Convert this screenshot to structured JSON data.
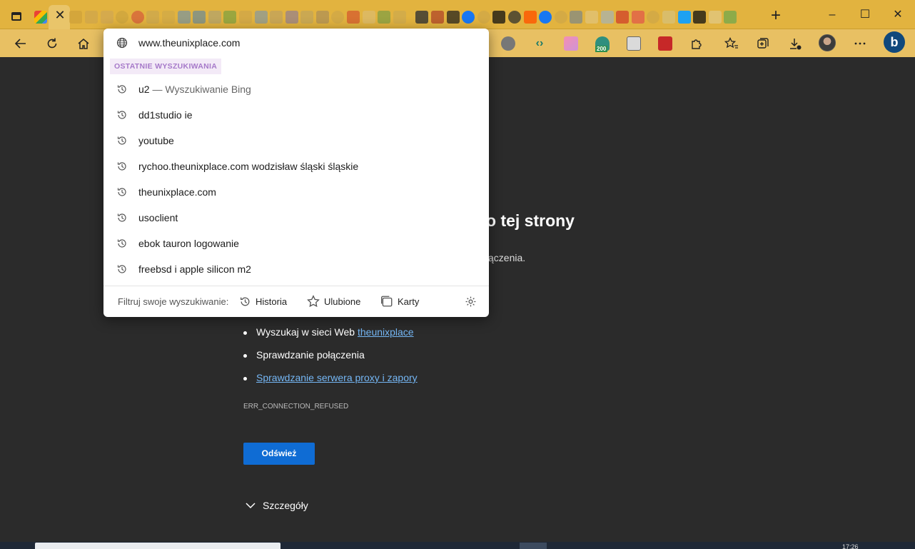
{
  "browser": {
    "tab_close_glyph": "✕",
    "new_tab_glyph": "+",
    "accent_color": "#e2b33f",
    "window_controls": [
      "–",
      "☐",
      "✕"
    ]
  },
  "omnibox": {
    "url_suggestion": "www.theunixplace.com",
    "section_header": "OSTATNIE WYSZUKIWANIA",
    "recent_searches": [
      {
        "text": "u2",
        "suffix": " — Wyszukiwanie Bing"
      },
      {
        "text": "dd1studio ie",
        "suffix": ""
      },
      {
        "text": "youtube",
        "suffix": ""
      },
      {
        "text": "rychoo.theunixplace.com wodzisław śląski śląskie",
        "suffix": ""
      },
      {
        "text": "theunixplace.com",
        "suffix": ""
      },
      {
        "text": "usoclient",
        "suffix": ""
      },
      {
        "text": "ebok tauron logowanie",
        "suffix": ""
      },
      {
        "text": "freebsd i apple silicon m2",
        "suffix": ""
      }
    ],
    "filter": {
      "label": "Filtruj swoje wyszukiwanie:",
      "history": "Historia",
      "favorites": "Ulubione",
      "tabs": "Karty"
    }
  },
  "toolbar": {
    "badge_count": "200",
    "bing_label": "b"
  },
  "error_page": {
    "heading_visible": "o tej strony",
    "subtext_visible": "ączenia.",
    "suggestions": [
      {
        "prefix": "Wyszukaj w sieci Web ",
        "link": "theunixplace"
      },
      {
        "prefix": "Sprawdzanie połączenia",
        "link": ""
      },
      {
        "prefix": "",
        "link": "Sprawdzanie serwera proxy i zapory"
      }
    ],
    "error_code": "ERR_CONNECTION_REFUSED",
    "reload_button": "Odśwież",
    "details_label": "Szczegóły"
  },
  "taskbar": {
    "clock_partial": "17:26"
  }
}
